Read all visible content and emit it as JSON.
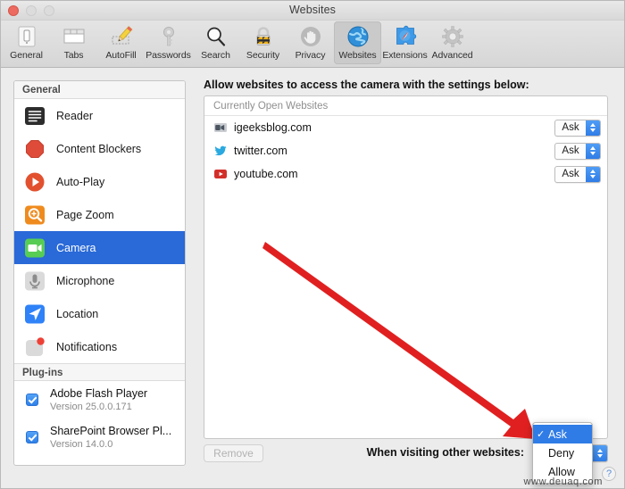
{
  "window": {
    "title": "Websites",
    "traffic_lights": [
      "close",
      "minimize",
      "zoom"
    ]
  },
  "toolbar": {
    "items": [
      {
        "label": "General",
        "icon": "general-icon",
        "selected": false
      },
      {
        "label": "Tabs",
        "icon": "tabs-icon",
        "selected": false
      },
      {
        "label": "AutoFill",
        "icon": "autofill-icon",
        "selected": false
      },
      {
        "label": "Passwords",
        "icon": "passwords-icon",
        "selected": false
      },
      {
        "label": "Search",
        "icon": "search-icon",
        "selected": false
      },
      {
        "label": "Security",
        "icon": "security-icon",
        "selected": false
      },
      {
        "label": "Privacy",
        "icon": "privacy-icon",
        "selected": false
      },
      {
        "label": "Websites",
        "icon": "websites-icon",
        "selected": true
      },
      {
        "label": "Extensions",
        "icon": "extensions-icon",
        "selected": false
      },
      {
        "label": "Advanced",
        "icon": "advanced-icon",
        "selected": false
      }
    ]
  },
  "sidebar": {
    "general_header": "General",
    "general_items": [
      {
        "label": "Reader",
        "icon": "reader-icon",
        "selected": false
      },
      {
        "label": "Content Blockers",
        "icon": "content-blockers-icon",
        "selected": false
      },
      {
        "label": "Auto-Play",
        "icon": "auto-play-icon",
        "selected": false
      },
      {
        "label": "Page Zoom",
        "icon": "page-zoom-icon",
        "selected": false
      },
      {
        "label": "Camera",
        "icon": "camera-icon",
        "selected": true
      },
      {
        "label": "Microphone",
        "icon": "microphone-icon",
        "selected": false
      },
      {
        "label": "Location",
        "icon": "location-icon",
        "selected": false
      },
      {
        "label": "Notifications",
        "icon": "notifications-icon",
        "selected": false
      }
    ],
    "plugins_header": "Plug-ins",
    "plugins": [
      {
        "name": "Adobe Flash Player",
        "version": "Version 25.0.0.171",
        "checked": true
      },
      {
        "name": "SharePoint Browser Pl...",
        "version": "Version 14.0.0",
        "checked": true
      }
    ]
  },
  "main": {
    "intro": "Allow websites to access the camera with the settings below:",
    "list_header": "Currently Open Websites",
    "rows": [
      {
        "site": "igeeksblog.com",
        "favicon": "igeeksblog-favicon",
        "permission": "Ask"
      },
      {
        "site": "twitter.com",
        "favicon": "twitter-favicon",
        "permission": "Ask"
      },
      {
        "site": "youtube.com",
        "favicon": "youtube-favicon",
        "permission": "Ask"
      }
    ],
    "remove_label": "Remove",
    "when_visiting_label": "When visiting other websites:",
    "when_visiting_value": "Ask"
  },
  "dropdown": {
    "open": true,
    "items": [
      {
        "label": "Ask",
        "checked": true
      },
      {
        "label": "Deny",
        "checked": false
      },
      {
        "label": "Allow",
        "checked": false
      }
    ]
  },
  "help": {
    "label": "?"
  },
  "watermark": {
    "text": "www.deuaq.com"
  },
  "colors": {
    "selection_blue": "#2969d8",
    "menu_highlight": "#2f7ce6",
    "annotation_red": "#e02020",
    "window_bg": "#ececec",
    "panel_bg": "#ffffff"
  }
}
